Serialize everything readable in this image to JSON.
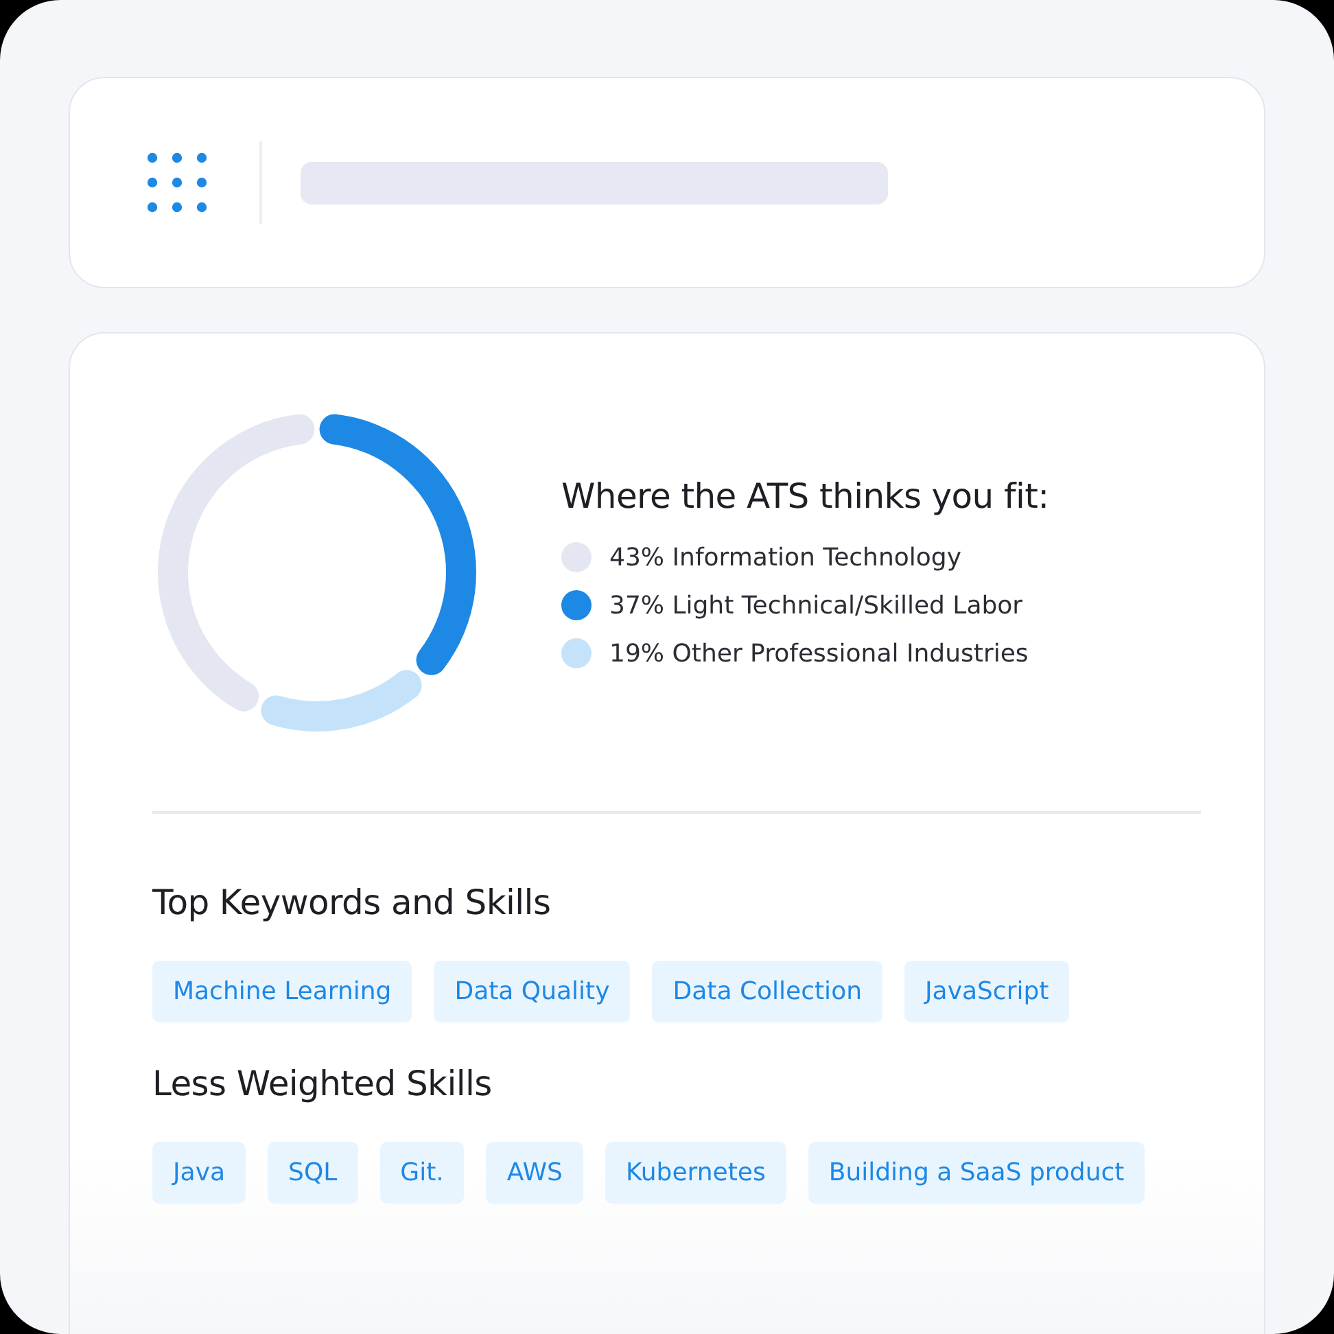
{
  "header": {
    "kind": "skeleton"
  },
  "fit": {
    "title": "Where the ATS thinks you fit:",
    "legend": [
      {
        "share": "43%",
        "color": "#e4e7f1"
      },
      {
        "share": "37%",
        "color": "#1e88e5"
      },
      {
        "share": "19%",
        "color": "#c4e3fa"
      }
    ],
    "chart_data": {
      "type": "donut",
      "categories": [
        "Information Technology",
        "Light Technical/Skilled Labor",
        "Other Professional Industries"
      ],
      "values": [
        43,
        37,
        19
      ]
    }
  },
  "sections": [
    {
      "title": "Top Keywords and Skills",
      "tags": [
        "Machine Learning",
        "Data Quality",
        "Data Collection",
        "JavaScript"
      ]
    },
    {
      "title": "Less Weighted Skills",
      "tags": [
        "Java",
        "SQL",
        "Git.",
        "AWS",
        "Kubernetes",
        "Building a SaaS product"
      ]
    }
  ]
}
